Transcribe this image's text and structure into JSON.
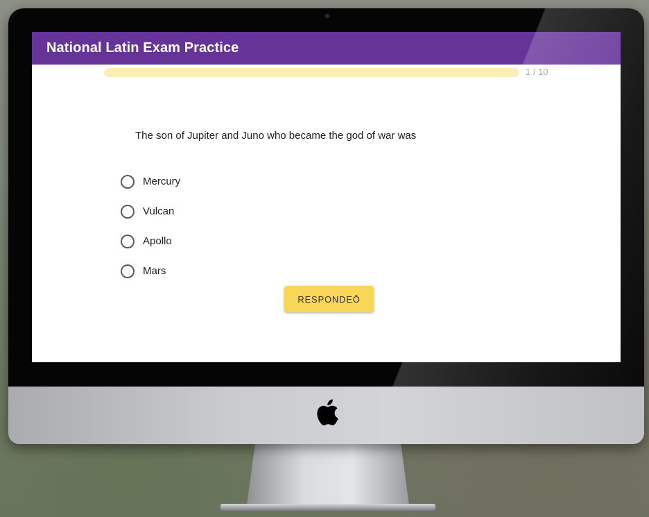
{
  "app": {
    "title": "National Latin Exam Practice"
  },
  "progress": {
    "label": "1 / 10",
    "fraction": 0.0
  },
  "question": {
    "text": "The son of Jupiter and Juno who became the god of war was",
    "options": [
      "Mercury",
      "Vulcan",
      "Apollo",
      "Mars"
    ]
  },
  "actions": {
    "submit_label": "RESPONDEŌ"
  },
  "colors": {
    "header": "#663399",
    "accent": "#f7d658",
    "progress_track": "#fbeeb9"
  },
  "icons": {
    "brand": "apple-logo-icon",
    "camera": "camera-icon"
  }
}
